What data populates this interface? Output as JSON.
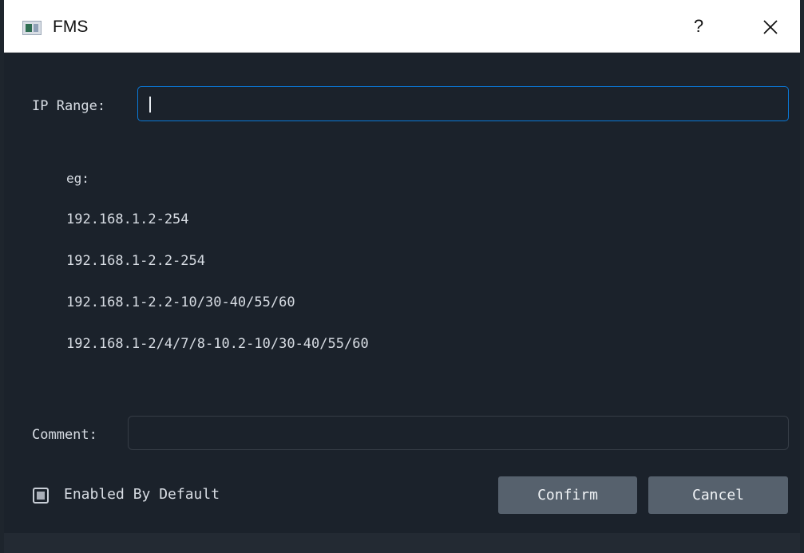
{
  "window": {
    "title": "FMS",
    "help_label": "?",
    "close_icon": "close-icon"
  },
  "form": {
    "ip_range_label": "IP Range:",
    "ip_range_value": "",
    "examples_label": "eg:",
    "examples": [
      "192.168.1.2-254",
      "192.168.1-2.2-254",
      "192.168.1-2.2-10/30-40/55/60",
      "192.168.1-2/4/7/8-10.2-10/30-40/55/60"
    ],
    "comment_label": "Comment:",
    "comment_value": "",
    "enabled_label": "Enabled By Default",
    "enabled_state": "indeterminate"
  },
  "buttons": {
    "confirm": "Confirm",
    "cancel": "Cancel"
  },
  "colors": {
    "background": "#1b222b",
    "title_bar": "#ffffff",
    "focus_border": "#0a78d7",
    "button": "#56616d",
    "text": "#d8dde4"
  }
}
